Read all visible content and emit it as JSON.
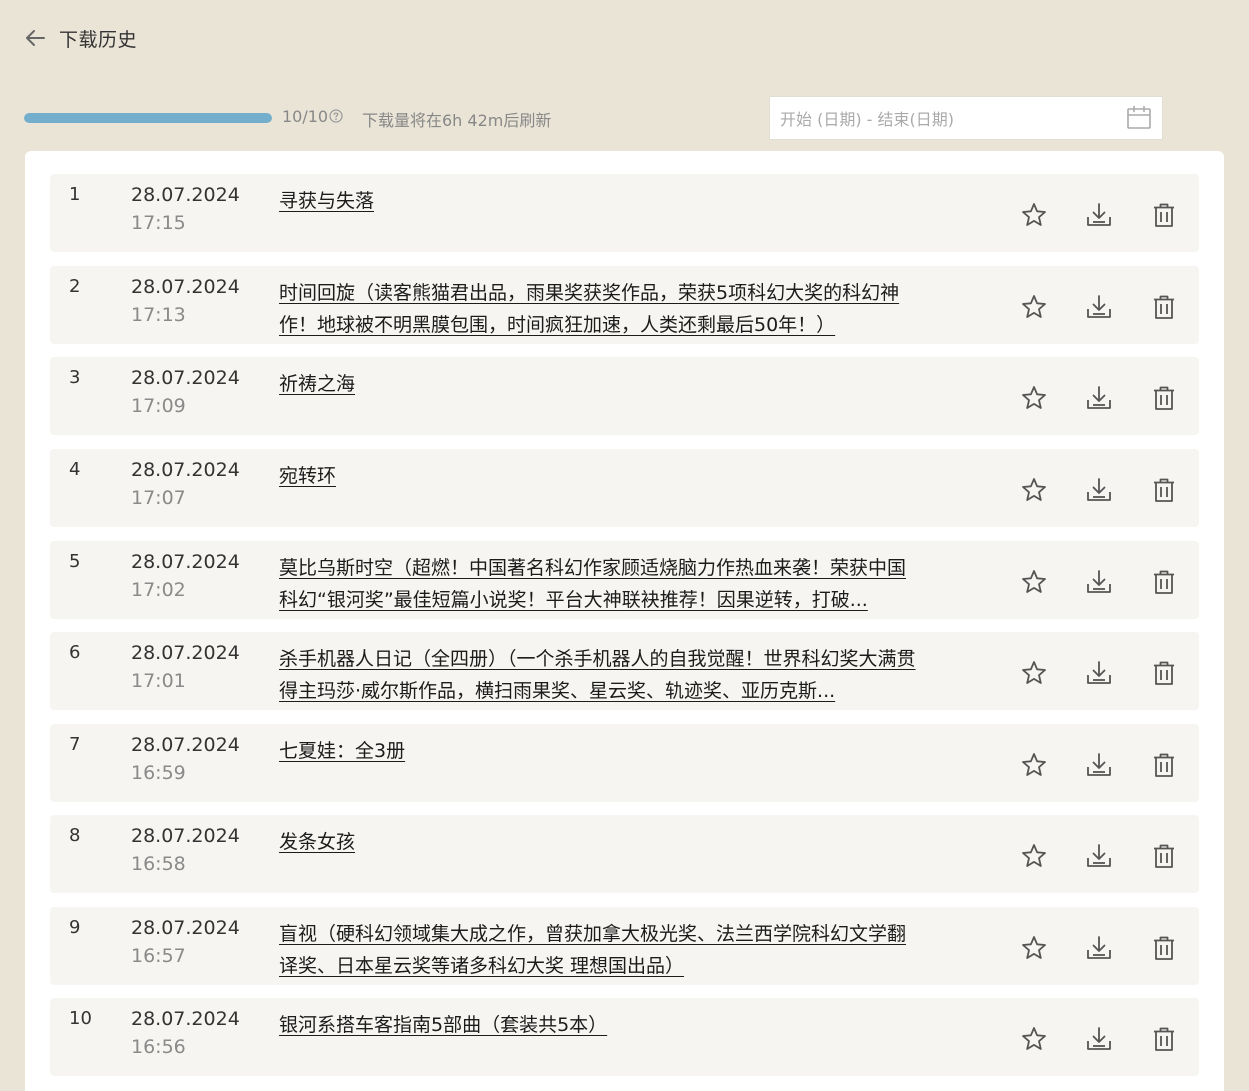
{
  "header": {
    "title": "下载历史",
    "back_icon": "arrow-left-icon"
  },
  "toolbar": {
    "quota_label": "10/10",
    "quota_used_fraction": 1.0,
    "refresh_note": "下载量将在6h 42m后刷新",
    "date_range_placeholder": "开始 (日期) - 结束(日期)",
    "help_icon": "question-circle-icon",
    "calendar_icon": "calendar-icon"
  },
  "colors": {
    "background": "#e9e4d6",
    "progress": "#74aecd",
    "row_background": "#f6f5f1"
  },
  "rows": [
    {
      "index": "1",
      "date": "28.07.2024",
      "time": "17:15",
      "title": "寻获与失落"
    },
    {
      "index": "2",
      "date": "28.07.2024",
      "time": "17:13",
      "title": "时间回旋（读客熊猫君出品，雨果奖获奖作品，荣获5项科幻大奖的科幻神作！地球被不明黑膜包围，时间疯狂加速，人类还剩最后50年！）"
    },
    {
      "index": "3",
      "date": "28.07.2024",
      "time": "17:09",
      "title": "祈祷之海"
    },
    {
      "index": "4",
      "date": "28.07.2024",
      "time": "17:07",
      "title": "宛转环"
    },
    {
      "index": "5",
      "date": "28.07.2024",
      "time": "17:02",
      "title": "莫比乌斯时空（超燃！中国著名科幻作家顾适烧脑力作热血来袭！荣获中国科幻“银河奖”最佳短篇小说奖！平台大神联袂推荐！因果逆转，打破..."
    },
    {
      "index": "6",
      "date": "28.07.2024",
      "time": "17:01",
      "title": "杀手机器人日记（全四册）（一个杀手机器人的自我觉醒！世界科幻奖大满贯得主玛莎·威尔斯作品，横扫雨果奖、星云奖、轨迹奖、亚历克斯..."
    },
    {
      "index": "7",
      "date": "28.07.2024",
      "time": "16:59",
      "title": "七夏娃：全3册"
    },
    {
      "index": "8",
      "date": "28.07.2024",
      "time": "16:58",
      "title": "发条女孩"
    },
    {
      "index": "9",
      "date": "28.07.2024",
      "time": "16:57",
      "title": "盲视（硬科幻领域集大成之作，曾获加拿大极光奖、法兰西学院科幻文学翻译奖、日本星云奖等诸多科幻大奖 理想国出品）"
    },
    {
      "index": "10",
      "date": "28.07.2024",
      "time": "16:56",
      "title": "银河系搭车客指南5部曲（套装共5本）"
    }
  ],
  "row_actions": {
    "favorite_icon": "star-icon",
    "download_icon": "download-icon",
    "delete_icon": "trash-icon"
  }
}
